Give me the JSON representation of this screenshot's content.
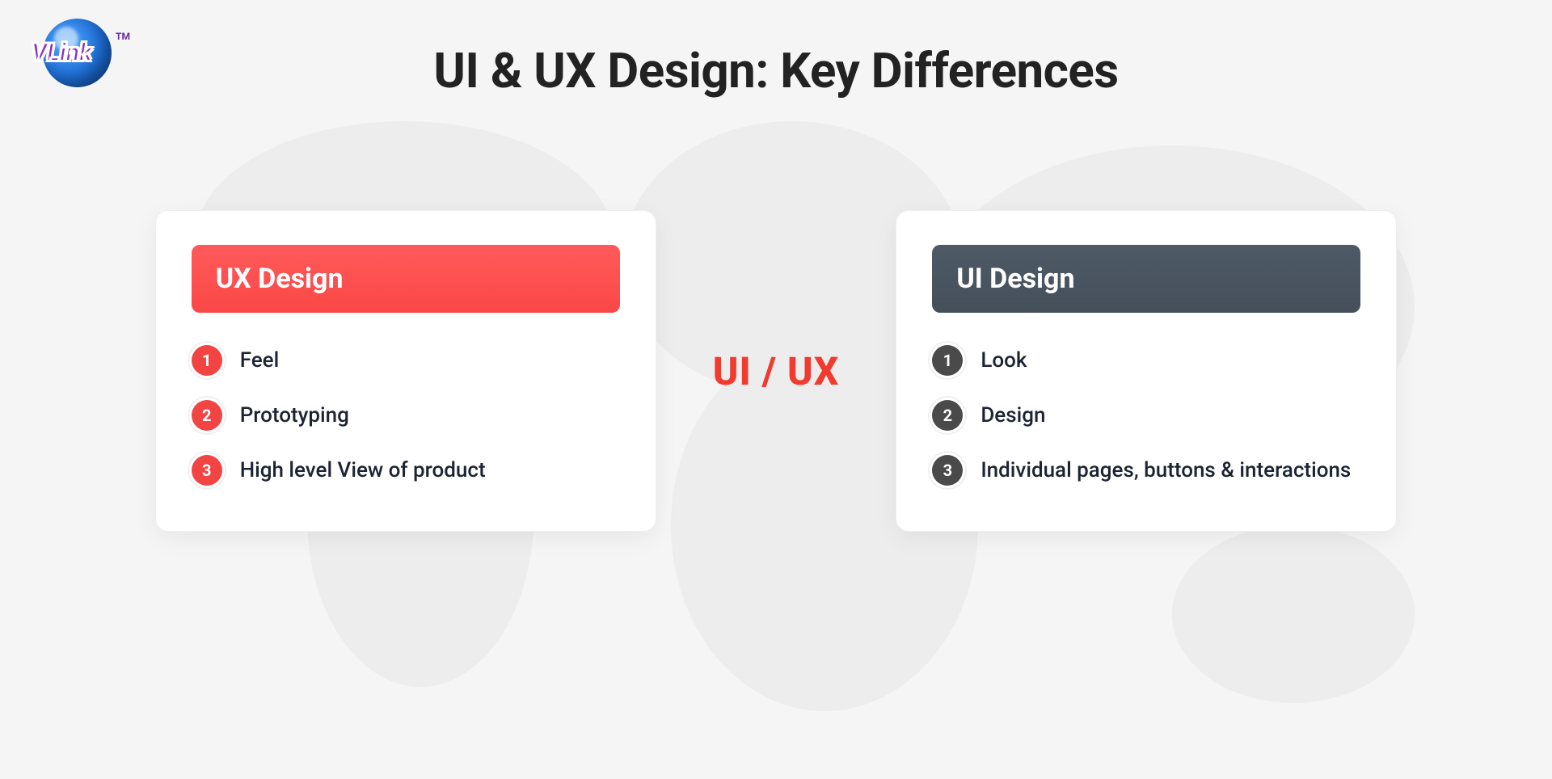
{
  "logo": {
    "text": "VLink",
    "tm": "TM"
  },
  "title": "UI & UX Design: Key Differences",
  "center_label": "UI / UX",
  "left_card": {
    "title": "UX Design",
    "items": [
      {
        "num": "1",
        "text": "Feel"
      },
      {
        "num": "2",
        "text": "Prototyping"
      },
      {
        "num": "3",
        "text": "High level View of product"
      }
    ]
  },
  "right_card": {
    "title": "UI Design",
    "items": [
      {
        "num": "1",
        "text": "Look"
      },
      {
        "num": "2",
        "text": "Design"
      },
      {
        "num": "3",
        "text": "Individual pages, buttons & interactions"
      }
    ]
  },
  "colors": {
    "red": "#f34444",
    "dark": "#4a4a4a",
    "accent": "#f23b2f"
  }
}
